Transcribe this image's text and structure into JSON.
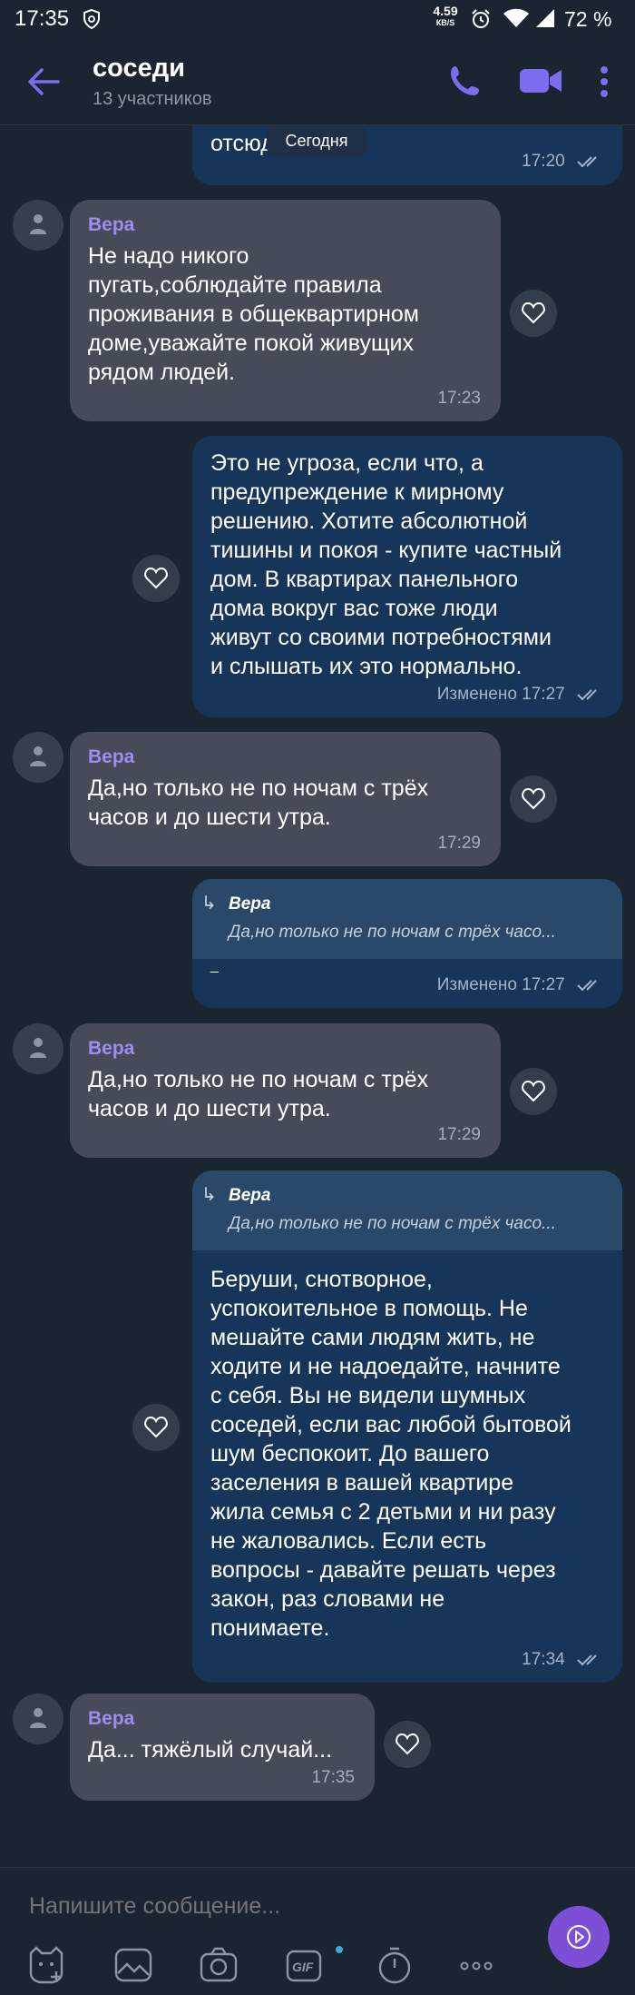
{
  "status_bar": {
    "time": "17:35",
    "net_speed_value": "4.59",
    "net_speed_unit": "КВ/S",
    "battery": "72 %"
  },
  "header": {
    "title": "соседи",
    "subtitle": "13 участников"
  },
  "date_pill": "Сегодня",
  "messages": [
    {
      "id": "m0",
      "direction": "out",
      "text": "отсюда",
      "time": "17:20",
      "read": true
    },
    {
      "id": "m1",
      "direction": "in",
      "sender": "Вера",
      "text": "Не надо никого\nпугать,соблюдайте правила\nпроживания в общеквартирном\nдоме,уважайте покой живущих\nрядом людей.",
      "time": "17:23"
    },
    {
      "id": "m2",
      "direction": "out",
      "text": "Это не угроза, если что, а\nпредупреждение к мирному\nрешению. Хотите абсолютной\nтишины и покоя - купите частный\nдом. В квартирах панельного\nдома вокруг вас тоже люди\nживут со своими потребностями\nи слышать их это нормально.",
      "time": "Изменено 17:27",
      "read": true
    },
    {
      "id": "m3",
      "direction": "in",
      "sender": "Вера",
      "text": "Да,но только не по ночам с трёх\nчасов и до шести утра.",
      "time": "17:29"
    },
    {
      "id": "m4",
      "direction": "out",
      "reply_to": {
        "name": "Вера",
        "text": "Да,но только не по ночам с трёх часо..."
      },
      "text": "_",
      "time": "Изменено 17:27",
      "read": true
    },
    {
      "id": "m5",
      "direction": "in",
      "sender": "Вера",
      "text": "Да,но только не по ночам с трёх\nчасов и до шести утра.",
      "time": "17:29"
    },
    {
      "id": "m6",
      "direction": "out",
      "reply_to": {
        "name": "Вера",
        "text": "Да,но только не по ночам с трёх часо..."
      },
      "text": "Беруши, снотворное,\nуспокоительное в помощь. Не\nмешайте сами людям жить, не\nходите и не надоедайте, начните\nс себя. Вы не видели шумных\nсоседей, если вас любой бытовой\nшум беспокоит. До вашего\nзаселения в вашей квартире\nжила семья с 2 детьми и ни разу\nне жаловались. Если есть\nвопросы - давайте решать через\nзакон, раз словами не\nпонимаете.",
      "time": "17:34",
      "read": true
    },
    {
      "id": "m7",
      "direction": "in",
      "sender": "Вера",
      "text": "Да... тяжёлый случай...",
      "time": "17:35"
    }
  ],
  "composer": {
    "placeholder": "Напишите сообщение...",
    "tools": [
      "sticker-icon",
      "gallery-icon",
      "camera-icon",
      "gif-icon",
      "timer-icon",
      "more-icon"
    ]
  },
  "colors": {
    "background": "#1b2431",
    "incoming_bubble": "#454c58",
    "outgoing_bubble": "#163558",
    "accent": "#7c4fd6",
    "sender_name": "#9c8df0"
  }
}
